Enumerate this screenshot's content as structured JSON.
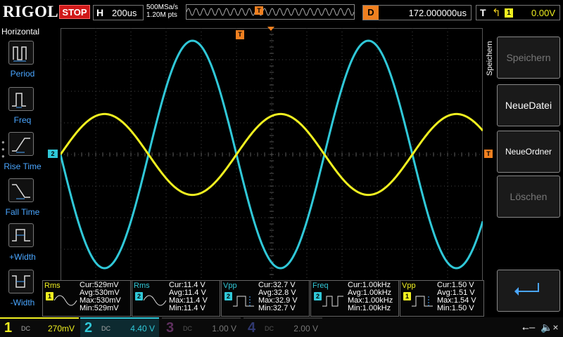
{
  "topbar": {
    "logo": "RIGOL",
    "run_state": "STOP",
    "horizontal_label": "H",
    "timebase": "200us",
    "sample_rate": "500MSa/s",
    "memory_depth": "1.20M pts",
    "trigger_marker": "T",
    "delay_label": "D",
    "delay_value": "172.000000us",
    "trigger_label": "T",
    "trigger_edge_icon": "rising-edge-icon",
    "trigger_source": "1",
    "trigger_level": "0.00V"
  },
  "left_menu": {
    "title": "Horizontal",
    "items": [
      {
        "label": "Period",
        "icon": "period-icon"
      },
      {
        "label": "Freq",
        "icon": "freq-icon"
      },
      {
        "label": "Rise Time",
        "icon": "rise-time-icon"
      },
      {
        "label": "Fall Time",
        "icon": "fall-time-icon"
      },
      {
        "label": "+Width",
        "icon": "positive-width-icon"
      },
      {
        "label": "-Width",
        "icon": "negative-width-icon"
      }
    ]
  },
  "screen": {
    "ch2_marker": "2",
    "trigger_level_marker": "T",
    "trigger_pos_marker": "T",
    "traces": [
      {
        "channel": "1",
        "color": "#f0f020",
        "amplitude": 0.32,
        "phase_deg": 0,
        "cycles": 2.4
      },
      {
        "channel": "2",
        "color": "#30c8d8",
        "amplitude": 0.9,
        "phase_deg": 180,
        "cycles": 2.4
      }
    ]
  },
  "right_menu": {
    "title": "Speichern",
    "buttons": [
      {
        "label": "Speichern",
        "enabled": false
      },
      {
        "label": "NeueDatei",
        "enabled": true
      },
      {
        "label": "NeueOrdner",
        "enabled": true
      },
      {
        "label": "Löschen",
        "enabled": false
      },
      {
        "label": "",
        "icon": "return-arrow-icon",
        "enabled": true
      }
    ]
  },
  "measurements": [
    {
      "name": "Rms",
      "channel": "1",
      "color": "#f0f020",
      "cur": "Cur:529mV",
      "avg": "Avg:530mV",
      "max": "Max:530mV",
      "min": "Min:529mV"
    },
    {
      "name": "Rms",
      "channel": "2",
      "color": "#30c8d8",
      "cur": "Cur:11.4 V",
      "avg": "Avg:11.4 V",
      "max": "Max:11.4 V",
      "min": "Min:11.4 V"
    },
    {
      "name": "Vpp",
      "channel": "2",
      "color": "#30c8d8",
      "cur": "Cur:32.7 V",
      "avg": "Avg:32.8 V",
      "max": "Max:32.9 V",
      "min": "Min:32.7 V"
    },
    {
      "name": "Freq",
      "channel": "2",
      "color": "#30c8d8",
      "cur": "Cur:1.00kHz",
      "avg": "Avg:1.00kHz",
      "max": "Max:1.00kHz",
      "min": "Min:1.00kHz"
    },
    {
      "name": "Vpp",
      "channel": "1",
      "color": "#f0f020",
      "cur": "Cur:1.50 V",
      "avg": "Avg:1.51 V",
      "max": "Max:1.54 V",
      "min": "Min:1.50 V"
    }
  ],
  "channels": [
    {
      "num": "1",
      "coupling": "DC",
      "scale": "270mV",
      "color": "#f0f020",
      "active": true
    },
    {
      "num": "2",
      "coupling": "DC",
      "scale": "4.40 V",
      "color": "#30c8d8",
      "active": true
    },
    {
      "num": "3",
      "coupling": "DC",
      "scale": "1.00 V",
      "color": "#c040c0",
      "active": false
    },
    {
      "num": "4",
      "coupling": "DC",
      "scale": "2.00 V",
      "color": "#4060d0",
      "active": false
    }
  ],
  "status": {
    "usb_icon": "usb-icon",
    "sound_icon": "mute-icon"
  }
}
